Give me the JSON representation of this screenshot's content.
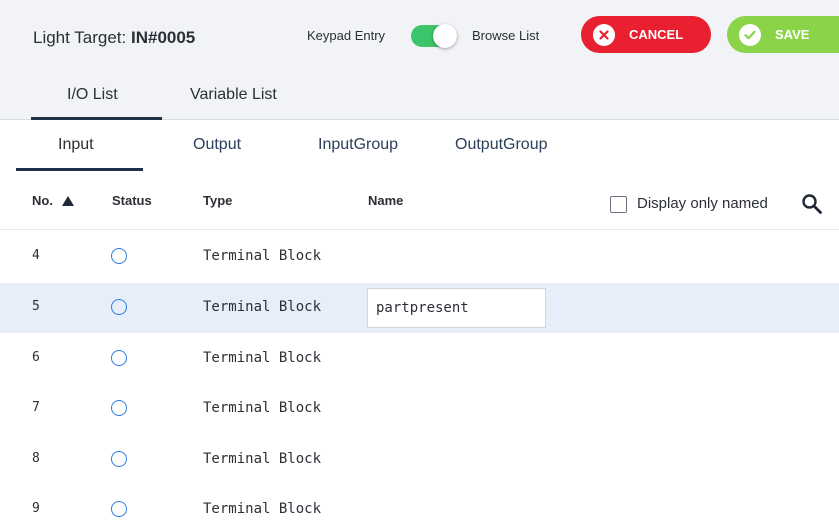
{
  "header": {
    "title_prefix": "Light Target: ",
    "title_value": "IN#0005",
    "keypad_label": "Keypad Entry",
    "browse_label": "Browse List",
    "toggle_state": "on",
    "cancel_label": "CANCEL",
    "save_label": "SAVE",
    "colors": {
      "cancel": "#e8202f",
      "save": "#8bd449",
      "toggle": "#3cc46a"
    }
  },
  "main_tabs": [
    {
      "label": "I/O List",
      "active": true
    },
    {
      "label": "Variable List",
      "active": false
    }
  ],
  "sub_tabs": [
    {
      "label": "Input",
      "active": true
    },
    {
      "label": "Output",
      "active": false
    },
    {
      "label": "InputGroup",
      "active": false
    },
    {
      "label": "OutputGroup",
      "active": false
    }
  ],
  "columns": {
    "no": "No.",
    "status": "Status",
    "type": "Type",
    "name": "Name",
    "sort_column": "No.",
    "sort_direction": "ascending"
  },
  "filter": {
    "label": "Display only named",
    "checked": false
  },
  "rows": [
    {
      "no": "4",
      "status": "inactive",
      "type": "Terminal Block",
      "name": "",
      "selected": false
    },
    {
      "no": "5",
      "status": "inactive",
      "type": "Terminal Block",
      "name": "partpresent",
      "selected": true
    },
    {
      "no": "6",
      "status": "inactive",
      "type": "Terminal Block",
      "name": "",
      "selected": false
    },
    {
      "no": "7",
      "status": "inactive",
      "type": "Terminal Block",
      "name": "",
      "selected": false
    },
    {
      "no": "8",
      "status": "inactive",
      "type": "Terminal Block",
      "name": "",
      "selected": false
    },
    {
      "no": "9",
      "status": "inactive",
      "type": "Terminal Block",
      "name": "",
      "selected": false
    }
  ],
  "icons": {
    "cancel": "close-circle-icon",
    "save": "check-circle-icon",
    "search": "search-icon",
    "sort": "sort-ascending-icon",
    "status": "status-circle-icon"
  }
}
